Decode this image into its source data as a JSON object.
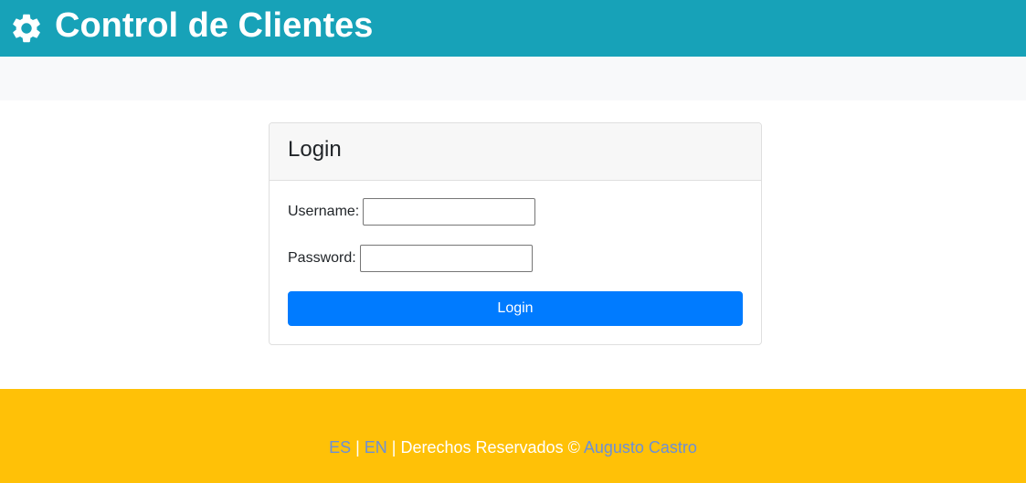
{
  "header": {
    "title": "Control de Clientes",
    "icon": "gear-icon",
    "background": "#17a2b8"
  },
  "login": {
    "title": "Login",
    "username_label": "Username:",
    "username_value": "",
    "password_label": "Password:",
    "password_value": "",
    "button_label": "Login",
    "button_color": "#007bff"
  },
  "footer": {
    "lang_es": "ES",
    "sep1": " | ",
    "lang_en": "EN",
    "sep2": " | ",
    "rights": "Derechos Reservados © ",
    "author": "Augusto Castro",
    "background": "#ffc107"
  }
}
